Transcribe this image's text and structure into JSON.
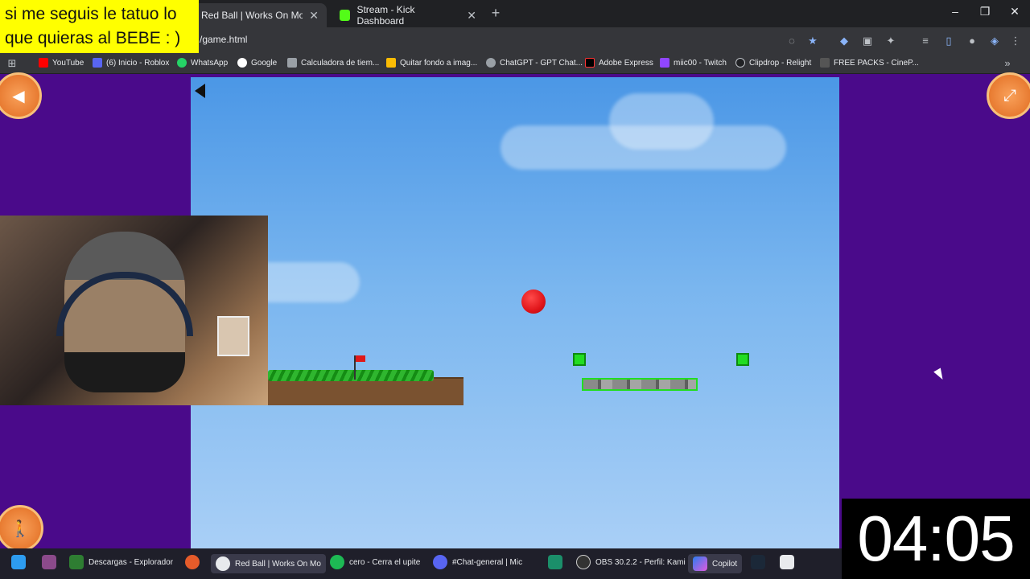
{
  "overlay_caption": "si me seguis le tatuo lo que quieras al BEBE : )",
  "timer": "04:05",
  "browser": {
    "tabs": [
      {
        "label": "Red Ball | Works On Mobile | Pl",
        "active": true
      },
      {
        "label": "Stream - Kick Dashboard",
        "active": false
      }
    ],
    "url": "/game.html",
    "bookmarks": [
      "YouTube",
      "(6) Inicio - Roblox",
      "WhatsApp",
      "Google",
      "Calculadora de tiem...",
      "Quitar fondo a imag...",
      "ChatGPT - GPT Chat...",
      "Adobe Express",
      "miic00 - Twitch",
      "Clipdrop - Relight",
      "FREE PACKS - CineP..."
    ]
  },
  "taskbar": {
    "items": [
      "Descargas - Explorador",
      "Red Ball | Works On Mo",
      "cero - Cerra el upite",
      "#Chat-general | Mic",
      "OBS 30.2.2 - Perfil: Kami",
      "Copilot"
    ]
  },
  "colors": {
    "caption_bg": "#ffff00",
    "page_bg": "#4a0a8a",
    "ball": "#e0151a",
    "checkpoint": "#22dd22",
    "accent_orange": "#e87a2a"
  }
}
